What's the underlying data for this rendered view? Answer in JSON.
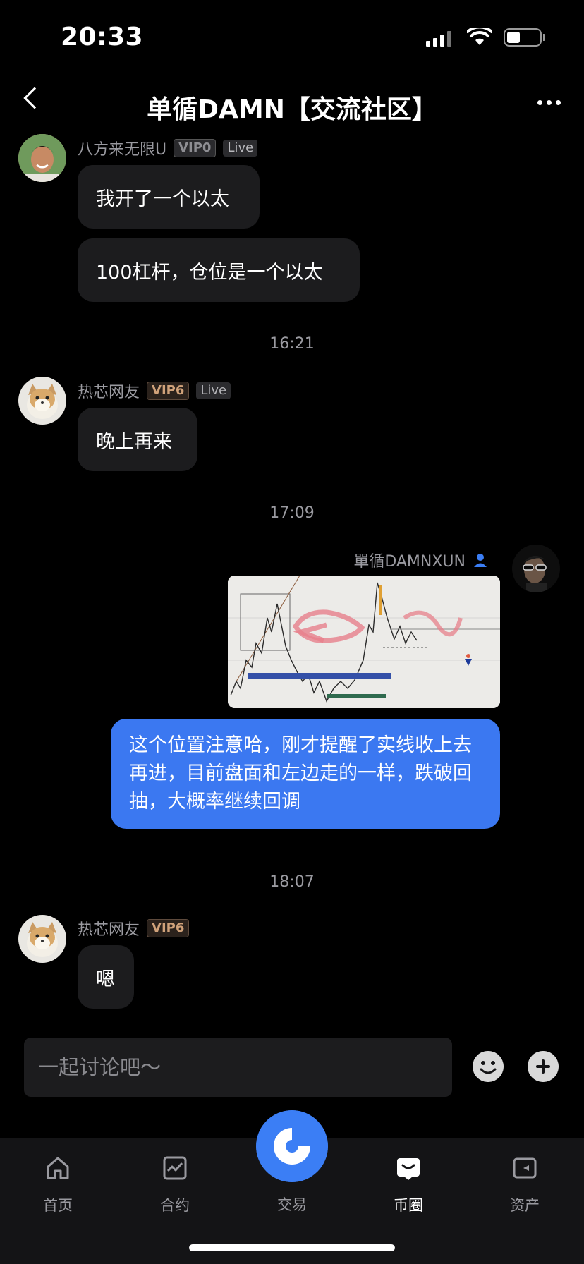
{
  "status_bar": {
    "time": "20:33"
  },
  "header": {
    "title": "单循DAMN【交流社区】"
  },
  "messages": [
    {
      "user": "八方来无限U",
      "vip": "VIP0",
      "live": "Live",
      "texts": [
        "我开了一个以太",
        "100杠杆，仓位是一个以太"
      ]
    },
    {
      "time": "16:21"
    },
    {
      "user": "热芯网友",
      "vip": "VIP6",
      "live": "Live",
      "texts": [
        "晚上再来"
      ]
    },
    {
      "time": "17:09"
    },
    {
      "user": "單循DAMNXUN",
      "self": true,
      "text": "这个位置注意哈，刚才提醒了实线收上去再进，目前盘面和左边走的一样，跌破回抽，大概率继续回调"
    },
    {
      "time": "18:07"
    },
    {
      "user": "热芯网友",
      "vip": "VIP6",
      "texts": [
        "嗯"
      ]
    }
  ],
  "input": {
    "placeholder": "一起讨论吧～"
  },
  "tabs": [
    {
      "label": "首页",
      "icon": "home-icon"
    },
    {
      "label": "合约",
      "icon": "chart-icon"
    },
    {
      "label": "交易",
      "icon": "trade-icon"
    },
    {
      "label": "币圈",
      "icon": "community-icon",
      "active": true
    },
    {
      "label": "资产",
      "icon": "wallet-icon"
    }
  ],
  "colors": {
    "accent": "#3b7ef5",
    "bubble_self": "#3b78f1",
    "bubble_other": "#1c1c1e"
  }
}
